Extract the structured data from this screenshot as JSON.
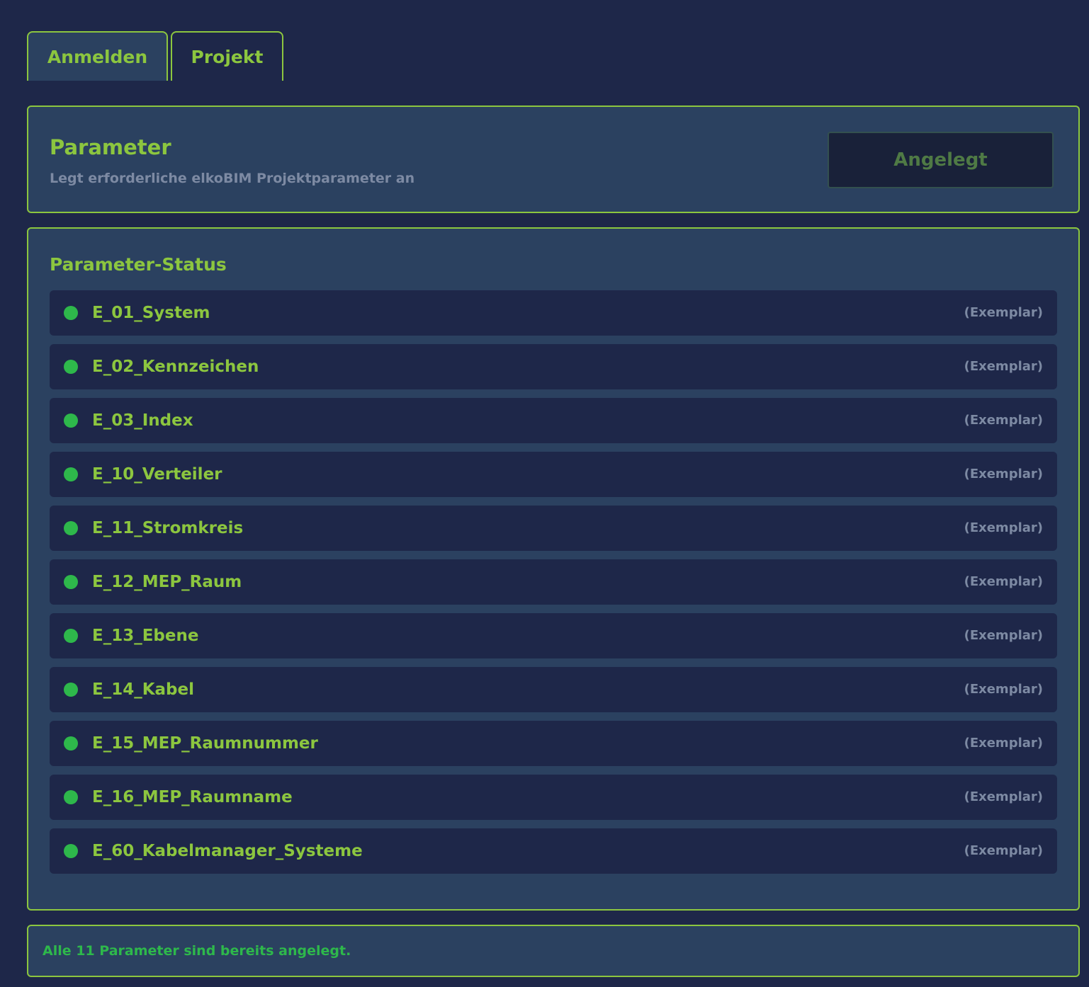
{
  "tabs": [
    {
      "label": "Anmelden"
    },
    {
      "label": "Projekt"
    }
  ],
  "parameter_panel": {
    "title": "Parameter",
    "subtitle": "Legt erforderliche elkoBIM Projektparameter an",
    "button_label": "Angelegt"
  },
  "status_panel": {
    "title": "Parameter-Status",
    "items": [
      {
        "name": "E_01_System",
        "type": "(Exemplar)"
      },
      {
        "name": "E_02_Kennzeichen",
        "type": "(Exemplar)"
      },
      {
        "name": "E_03_Index",
        "type": "(Exemplar)"
      },
      {
        "name": "E_10_Verteiler",
        "type": "(Exemplar)"
      },
      {
        "name": "E_11_Stromkreis",
        "type": "(Exemplar)"
      },
      {
        "name": "E_12_MEP_Raum",
        "type": "(Exemplar)"
      },
      {
        "name": "E_13_Ebene",
        "type": "(Exemplar)"
      },
      {
        "name": "E_14_Kabel",
        "type": "(Exemplar)"
      },
      {
        "name": "E_15_MEP_Raumnummer",
        "type": "(Exemplar)"
      },
      {
        "name": "E_16_MEP_Raumname",
        "type": "(Exemplar)"
      },
      {
        "name": "E_60_Kabelmanager_Systeme",
        "type": "(Exemplar)"
      }
    ]
  },
  "summary": {
    "message": "Alle 11 Parameter sind bereits angelegt."
  },
  "colors": {
    "background": "#1e2749",
    "panel": "#2b4160",
    "accent": "#8cc63f",
    "status_ok": "#2eb84b",
    "muted_text": "#7d8aa3"
  }
}
